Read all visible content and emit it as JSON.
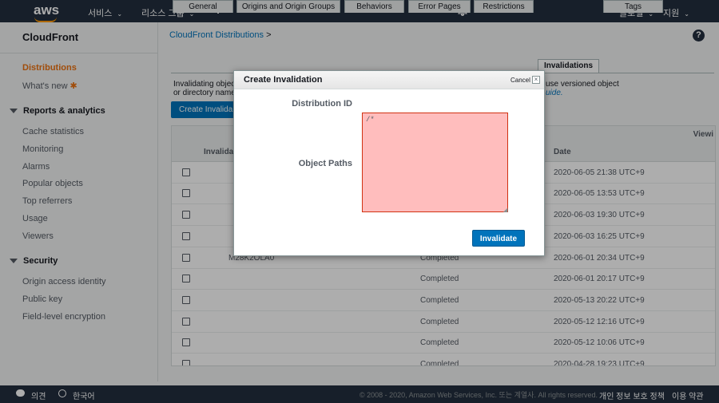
{
  "topnav": {
    "logo": "aws",
    "services": "서비스",
    "resource_groups": "리소스 그룹",
    "global": "글로벌",
    "support": "지원"
  },
  "sidebar": {
    "title": "CloudFront",
    "items": [
      {
        "label": "Distributions",
        "active": true
      },
      {
        "label": "What's new"
      }
    ],
    "sections": [
      {
        "label": "Reports & analytics",
        "items": [
          "Cache statistics",
          "Monitoring",
          "Alarms",
          "Popular objects",
          "Top referrers",
          "Usage",
          "Viewers"
        ]
      },
      {
        "label": "Security",
        "items": [
          "Origin access identity",
          "Public key",
          "Field-level encryption"
        ]
      }
    ]
  },
  "breadcrumb": {
    "link": "CloudFront Distributions",
    "sep": ">"
  },
  "tabs": [
    "General",
    "Origins and Origin Groups",
    "Behaviors",
    "Error Pages",
    "Restrictions",
    "Invalidations",
    "Tags"
  ],
  "description": {
    "line1": "Invalidating objec",
    "line2": "or directory name",
    "right1": "use versioned object",
    "right2": "uide."
  },
  "create_button": "Create Invalida",
  "table": {
    "view_label": "Viewi",
    "headers": {
      "id": "Invalida",
      "date": "Date"
    },
    "rows": [
      {
        "id": "",
        "status": "",
        "date": "2020-06-05 21:38 UTC+9"
      },
      {
        "id": "",
        "status": "",
        "date": "2020-06-05 13:53 UTC+9"
      },
      {
        "id": "",
        "status": "",
        "date": "2020-06-03 19:30 UTC+9"
      },
      {
        "id": "",
        "status": "",
        "date": "2020-06-03 16:25 UTC+9"
      },
      {
        "id": "M28K2OLA0",
        "status": "Completed",
        "date": "2020-06-01 20:34 UTC+9"
      },
      {
        "id": "",
        "status": "Completed",
        "date": "2020-06-01 20:17 UTC+9"
      },
      {
        "id": "",
        "status": "Completed",
        "date": "2020-05-13 20:22 UTC+9"
      },
      {
        "id": "",
        "status": "Completed",
        "date": "2020-05-12 12:16 UTC+9"
      },
      {
        "id": "",
        "status": "Completed",
        "date": "2020-05-12 10:06 UTC+9"
      },
      {
        "id": "",
        "status": "Completed",
        "date": "2020-04-28 19:23 UTC+9"
      }
    ]
  },
  "footer": {
    "feedback": "의견",
    "language": "한국어",
    "copyright": "© 2008 - 2020, Amazon Web Services, Inc. 또는 계열사. All rights reserved.",
    "privacy": "개인 정보 보호 정책",
    "terms": "이용 약관"
  },
  "modal": {
    "title": "Create Invalidation",
    "cancel": "Cancel",
    "close": "×",
    "distribution_id_label": "Distribution ID",
    "object_paths_label": "Object Paths",
    "object_paths_value": "/*",
    "invalidate_button": "Invalidate"
  },
  "colors": {
    "nav": "#232f3e",
    "accent": "#ec7211",
    "link": "#0073bb",
    "error_bg": "#ffbdbd"
  }
}
